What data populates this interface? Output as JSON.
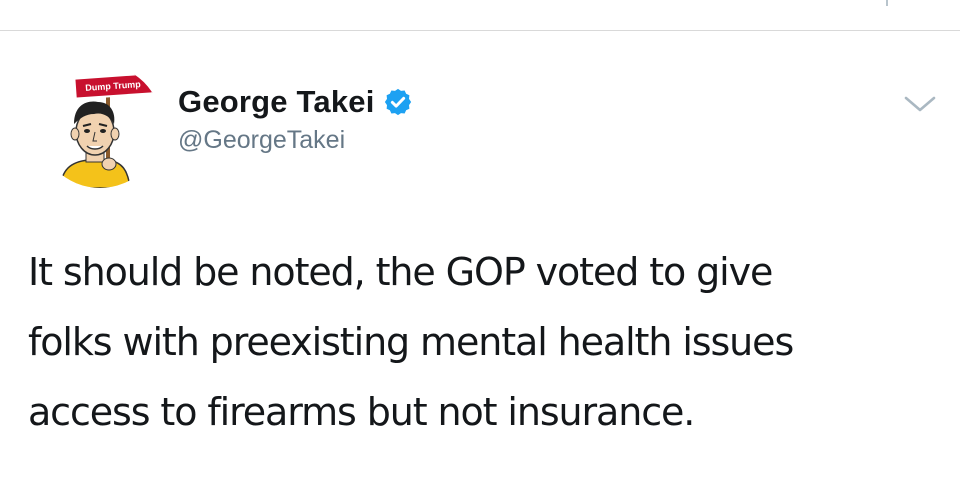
{
  "tweet": {
    "avatar": {
      "icon": "cartoon-avatar-holding-sign",
      "sign_text": "Dump Trump"
    },
    "author": {
      "display_name": "George Takei",
      "handle": "@GeorgeTakei",
      "verified": true,
      "verified_icon": "verified-badge-icon"
    },
    "menu_icon": "chevron-down-icon",
    "text": "It should be noted, the GOP voted to give\nfolks with preexisting mental health issues\naccess to firearms but not insurance."
  },
  "colors": {
    "verified_blue": "#1da1f2",
    "sign_red": "#c8102e",
    "handle_gray": "#657786",
    "divider": "#d9d9d9"
  }
}
